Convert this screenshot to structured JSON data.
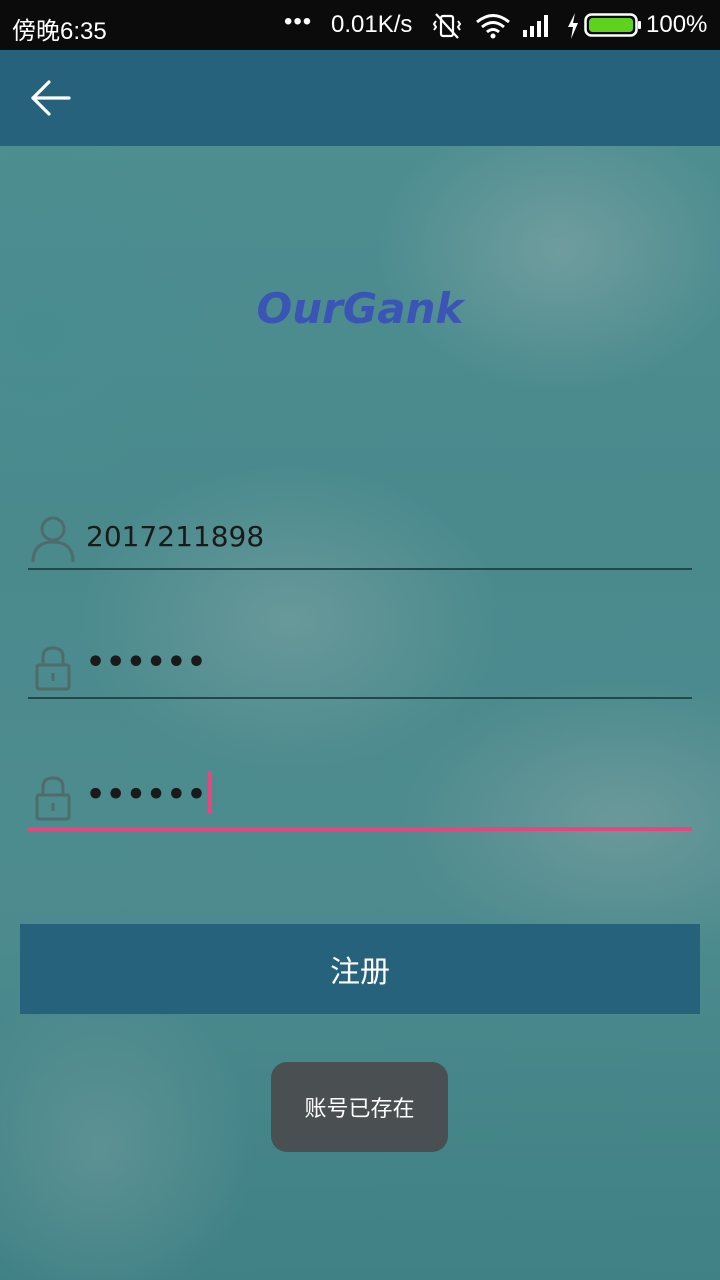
{
  "status_bar": {
    "time": "傍晚6:35",
    "more": "•••",
    "speed": "0.01K/s",
    "battery_percent": "100%",
    "icons": [
      "no-vibrate-icon",
      "wifi-icon",
      "signal-icon",
      "charging-icon",
      "battery-icon"
    ]
  },
  "app_bar": {
    "back_icon": "back-arrow-icon"
  },
  "logo": "OurGank",
  "form": {
    "username": {
      "icon": "user-icon",
      "value": "2017211898"
    },
    "password": {
      "icon": "lock-icon",
      "value": "••••••"
    },
    "confirm_password": {
      "icon": "lock-icon",
      "value": "••••••",
      "focused": true
    }
  },
  "register_button": "注册",
  "toast": "账号已存在",
  "colors": {
    "app_bar": "#27627c",
    "accent": "#e8457f",
    "logo": "#3a55b5",
    "toast_bg": "#4a5052"
  }
}
